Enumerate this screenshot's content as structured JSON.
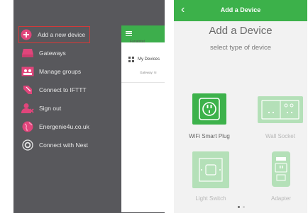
{
  "menu": {
    "items": [
      {
        "label": "Add a new device",
        "icon": "add-device-icon",
        "active": true
      },
      {
        "label": "Gateways",
        "icon": "gateway-icon"
      },
      {
        "label": "Manage groups",
        "icon": "groups-icon"
      },
      {
        "label": "Connect to IFTTT",
        "icon": "ifttt-icon"
      },
      {
        "label": "Sign out",
        "icon": "sign-out-icon"
      },
      {
        "label": "Energenie4u.co.uk",
        "icon": "globe-icon"
      },
      {
        "label": "Connect with Nest",
        "icon": "nest-icon"
      }
    ],
    "accent": "#e0457b",
    "active_border": "#d23a3a"
  },
  "peek": {
    "user": "Fanatstat",
    "devices_label": "My Devices",
    "sub_label": "Gateway: N"
  },
  "add_device": {
    "bar_title": "Add a Device",
    "heading": "Add a Device",
    "subheading": "select type of device",
    "tiles": [
      {
        "label": "WiFi Smart Plug",
        "icon": "smart-plug-icon",
        "state": "selected"
      },
      {
        "label": "Wall Socket",
        "icon": "wall-socket-icon",
        "state": "faded"
      },
      {
        "label": "Light Switch",
        "icon": "light-switch-icon",
        "state": "faded"
      },
      {
        "label": "Adapter",
        "icon": "adapter-icon",
        "state": "faded"
      }
    ],
    "page_dots": 2,
    "active_dot": 0,
    "green": "#3cb14a"
  }
}
